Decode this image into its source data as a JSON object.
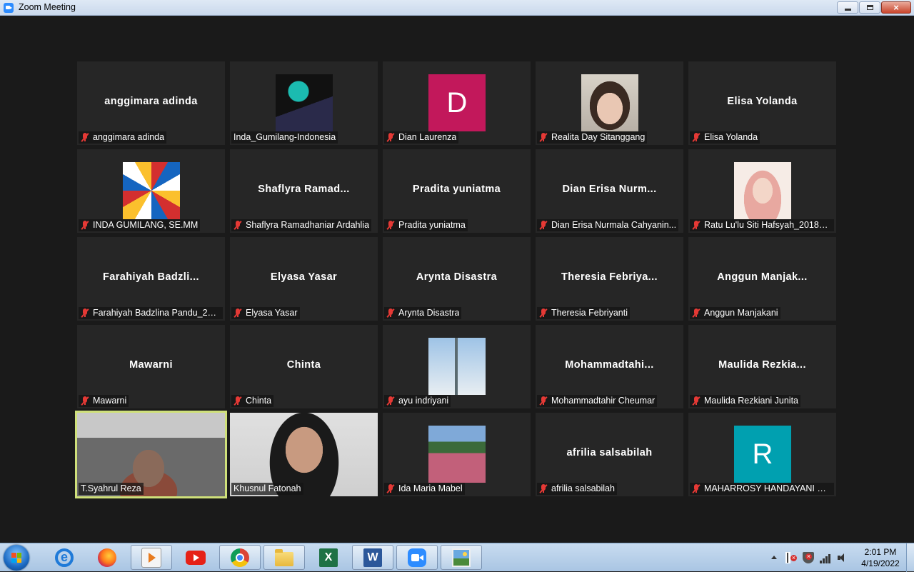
{
  "window": {
    "title": "Zoom Meeting",
    "minimize": "minimize",
    "maximize": "restore",
    "close": "×"
  },
  "tiles": [
    {
      "name": "anggimara adinda",
      "center": "anggimara adinda",
      "muted": true,
      "kind": "name"
    },
    {
      "name": "Inda_Gumilang-Indonesia",
      "center": "",
      "muted": false,
      "kind": "picture",
      "picture": "poster-art",
      "colors": [
        "#111111",
        "#1bbbb0",
        "#f4b400"
      ]
    },
    {
      "name": "Dian Laurenza",
      "center": "",
      "muted": true,
      "kind": "letter",
      "letter": "D",
      "color": "#c2185b"
    },
    {
      "name": "Realita Day Sitanggang",
      "center": "",
      "muted": true,
      "kind": "picture",
      "picture": "portrait-photo",
      "colors": [
        "#d8d2c8",
        "#3a2a22",
        "#e9c7b3"
      ]
    },
    {
      "name": "Elisa Yolanda",
      "center": "Elisa Yolanda",
      "muted": true,
      "kind": "name"
    },
    {
      "name": "INDA GUMILANG, SE.MM",
      "center": "",
      "muted": true,
      "kind": "picture",
      "picture": "asean-flags",
      "colors": [
        "#d32f2f",
        "#1565c0",
        "#fbc02d"
      ]
    },
    {
      "name": "Shaflyra Ramadhaniar Ardahlia",
      "center": "Shaflyra Ramad...",
      "muted": true,
      "kind": "name"
    },
    {
      "name": "Pradita yuniatma",
      "center": "Pradita yuniatma",
      "muted": true,
      "kind": "name"
    },
    {
      "name": "Dian Erisa Nurmala Cahyanin...",
      "center": "Dian Erisa Nurm...",
      "muted": true,
      "kind": "name"
    },
    {
      "name": "Ratu Lu'lu Siti Hafsyah_201811...",
      "center": "",
      "muted": true,
      "kind": "picture",
      "picture": "hijab-illustration",
      "colors": [
        "#f6ece6",
        "#e8a8a0",
        "#5a3a30"
      ]
    },
    {
      "name": "Farahiyah Badzlina Pandu_201...",
      "center": "Farahiyah Badzli...",
      "muted": true,
      "kind": "name"
    },
    {
      "name": "Elyasa Yasar",
      "center": "Elyasa Yasar",
      "muted": true,
      "kind": "name"
    },
    {
      "name": "Arynta Disastra",
      "center": "Arynta Disastra",
      "muted": true,
      "kind": "name"
    },
    {
      "name": "Theresia Febriyanti",
      "center": "Theresia Febriya...",
      "muted": true,
      "kind": "name"
    },
    {
      "name": "Anggun Manjakani",
      "center": "Anggun Manjak...",
      "muted": true,
      "kind": "name"
    },
    {
      "name": "Mawarni",
      "center": "Mawarni",
      "muted": true,
      "kind": "name"
    },
    {
      "name": "Chinta",
      "center": "Chinta",
      "muted": true,
      "kind": "name"
    },
    {
      "name": "ayu indriyani",
      "center": "",
      "muted": true,
      "kind": "picture",
      "picture": "bridge-photo",
      "colors": [
        "#9ec3e6",
        "#5a6a70",
        "#e8eef2"
      ]
    },
    {
      "name": "Mohammadtahir Cheumar",
      "center": "Mohammadtahi...",
      "muted": true,
      "kind": "name"
    },
    {
      "name": "Maulida Rezkiani Junita",
      "center": "Maulida Rezkia...",
      "muted": true,
      "kind": "name"
    },
    {
      "name": "T.Syahrul Reza",
      "center": "",
      "muted": false,
      "kind": "video",
      "video": "car-interior",
      "active": true,
      "colors": [
        "#6a6a6a",
        "#c8c8c8",
        "#8a4a3a"
      ]
    },
    {
      "name": "Khusnul Fatonah",
      "center": "",
      "muted": false,
      "kind": "video",
      "video": "webcam-person",
      "colors": [
        "#e0e0e0",
        "#1a1a1a",
        "#c89a80"
      ]
    },
    {
      "name": "Ida Maria Mabel",
      "center": "",
      "muted": true,
      "kind": "picture",
      "picture": "meadow-photo",
      "colors": [
        "#7fa9d8",
        "#3b6a3a",
        "#c2607a"
      ]
    },
    {
      "name": "afrilia salsabilah",
      "center": "afrilia salsabilah",
      "muted": true,
      "kind": "name"
    },
    {
      "name": "MAHARROSY HANDAYANI SA...",
      "center": "",
      "muted": true,
      "kind": "letter",
      "letter": "R",
      "color": "#00a0b0"
    }
  ],
  "taskbar": {
    "start_icon": "windows-start-icon",
    "apps": [
      {
        "icon": "internet-explorer-icon",
        "open": false
      },
      {
        "icon": "firefox-icon",
        "open": false
      },
      {
        "icon": "media-player-icon",
        "open": true
      },
      {
        "icon": "youtube-icon",
        "open": false
      },
      {
        "icon": "chrome-icon",
        "open": true
      },
      {
        "icon": "folder-icon",
        "open": true
      },
      {
        "icon": "excel-icon",
        "open": false
      },
      {
        "icon": "word-icon",
        "open": true
      },
      {
        "icon": "zoom-icon",
        "open": true
      },
      {
        "icon": "photo-viewer-icon",
        "open": true
      }
    ],
    "time": "2:01 PM",
    "date": "4/19/2022"
  }
}
